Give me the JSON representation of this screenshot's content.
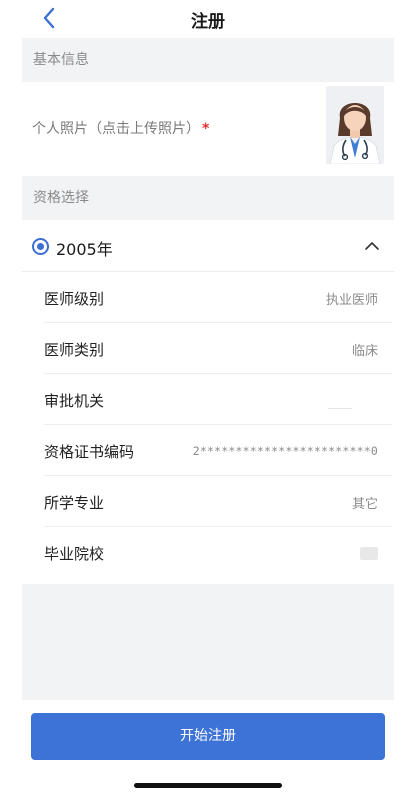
{
  "nav": {
    "title": "注册",
    "back_icon": "chevron-left-icon"
  },
  "sections": {
    "basic_info": "基本信息",
    "qualification": "资格选择"
  },
  "photo": {
    "label": "个人照片（点击上传照片）",
    "required_mark": "*"
  },
  "qualification": {
    "year_label": "2005年",
    "selected": true,
    "expanded": true
  },
  "info_rows": [
    {
      "label": "医师级别",
      "value": "执业医师"
    },
    {
      "label": "医师类别",
      "value": "临床"
    },
    {
      "label": "审批机关",
      "value": ""
    },
    {
      "label": "资格证书编码",
      "value": "2************************0"
    },
    {
      "label": "所学专业",
      "value": "其它"
    },
    {
      "label": "毕业院校",
      "value": ""
    }
  ],
  "submit": {
    "label": "开始注册"
  },
  "colors": {
    "accent": "#3d73d6",
    "required": "#e0302f",
    "section_bg": "#f2f3f5"
  }
}
